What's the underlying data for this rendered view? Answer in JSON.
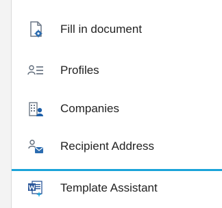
{
  "menu": {
    "items": [
      {
        "label": "Fill in document",
        "icon": "document-gear-icon"
      },
      {
        "label": "Profiles",
        "icon": "profiles-icon"
      },
      {
        "label": "Companies",
        "icon": "companies-icon"
      },
      {
        "label": "Recipient Address",
        "icon": "recipient-address-icon"
      },
      {
        "label": "Template Assistant",
        "icon": "word-template-icon"
      }
    ]
  },
  "colors": {
    "accent": "#1aa3d9",
    "word_blue": "#2b579a",
    "icon_gray": "#5f6b7a"
  }
}
